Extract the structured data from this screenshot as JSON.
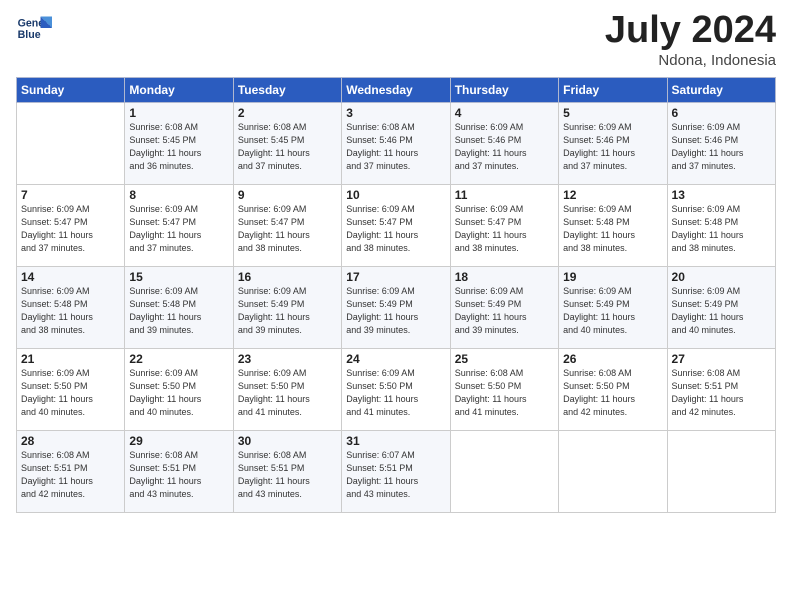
{
  "header": {
    "logo_line1": "General",
    "logo_line2": "Blue",
    "month": "July 2024",
    "location": "Ndona, Indonesia"
  },
  "weekdays": [
    "Sunday",
    "Monday",
    "Tuesday",
    "Wednesday",
    "Thursday",
    "Friday",
    "Saturday"
  ],
  "weeks": [
    [
      {
        "day": "",
        "info": ""
      },
      {
        "day": "1",
        "info": "Sunrise: 6:08 AM\nSunset: 5:45 PM\nDaylight: 11 hours\nand 36 minutes."
      },
      {
        "day": "2",
        "info": "Sunrise: 6:08 AM\nSunset: 5:45 PM\nDaylight: 11 hours\nand 37 minutes."
      },
      {
        "day": "3",
        "info": "Sunrise: 6:08 AM\nSunset: 5:46 PM\nDaylight: 11 hours\nand 37 minutes."
      },
      {
        "day": "4",
        "info": "Sunrise: 6:09 AM\nSunset: 5:46 PM\nDaylight: 11 hours\nand 37 minutes."
      },
      {
        "day": "5",
        "info": "Sunrise: 6:09 AM\nSunset: 5:46 PM\nDaylight: 11 hours\nand 37 minutes."
      },
      {
        "day": "6",
        "info": "Sunrise: 6:09 AM\nSunset: 5:46 PM\nDaylight: 11 hours\nand 37 minutes."
      }
    ],
    [
      {
        "day": "7",
        "info": "Sunrise: 6:09 AM\nSunset: 5:47 PM\nDaylight: 11 hours\nand 37 minutes."
      },
      {
        "day": "8",
        "info": "Sunrise: 6:09 AM\nSunset: 5:47 PM\nDaylight: 11 hours\nand 37 minutes."
      },
      {
        "day": "9",
        "info": "Sunrise: 6:09 AM\nSunset: 5:47 PM\nDaylight: 11 hours\nand 38 minutes."
      },
      {
        "day": "10",
        "info": "Sunrise: 6:09 AM\nSunset: 5:47 PM\nDaylight: 11 hours\nand 38 minutes."
      },
      {
        "day": "11",
        "info": "Sunrise: 6:09 AM\nSunset: 5:47 PM\nDaylight: 11 hours\nand 38 minutes."
      },
      {
        "day": "12",
        "info": "Sunrise: 6:09 AM\nSunset: 5:48 PM\nDaylight: 11 hours\nand 38 minutes."
      },
      {
        "day": "13",
        "info": "Sunrise: 6:09 AM\nSunset: 5:48 PM\nDaylight: 11 hours\nand 38 minutes."
      }
    ],
    [
      {
        "day": "14",
        "info": "Sunrise: 6:09 AM\nSunset: 5:48 PM\nDaylight: 11 hours\nand 38 minutes."
      },
      {
        "day": "15",
        "info": "Sunrise: 6:09 AM\nSunset: 5:48 PM\nDaylight: 11 hours\nand 39 minutes."
      },
      {
        "day": "16",
        "info": "Sunrise: 6:09 AM\nSunset: 5:49 PM\nDaylight: 11 hours\nand 39 minutes."
      },
      {
        "day": "17",
        "info": "Sunrise: 6:09 AM\nSunset: 5:49 PM\nDaylight: 11 hours\nand 39 minutes."
      },
      {
        "day": "18",
        "info": "Sunrise: 6:09 AM\nSunset: 5:49 PM\nDaylight: 11 hours\nand 39 minutes."
      },
      {
        "day": "19",
        "info": "Sunrise: 6:09 AM\nSunset: 5:49 PM\nDaylight: 11 hours\nand 40 minutes."
      },
      {
        "day": "20",
        "info": "Sunrise: 6:09 AM\nSunset: 5:49 PM\nDaylight: 11 hours\nand 40 minutes."
      }
    ],
    [
      {
        "day": "21",
        "info": "Sunrise: 6:09 AM\nSunset: 5:50 PM\nDaylight: 11 hours\nand 40 minutes."
      },
      {
        "day": "22",
        "info": "Sunrise: 6:09 AM\nSunset: 5:50 PM\nDaylight: 11 hours\nand 40 minutes."
      },
      {
        "day": "23",
        "info": "Sunrise: 6:09 AM\nSunset: 5:50 PM\nDaylight: 11 hours\nand 41 minutes."
      },
      {
        "day": "24",
        "info": "Sunrise: 6:09 AM\nSunset: 5:50 PM\nDaylight: 11 hours\nand 41 minutes."
      },
      {
        "day": "25",
        "info": "Sunrise: 6:08 AM\nSunset: 5:50 PM\nDaylight: 11 hours\nand 41 minutes."
      },
      {
        "day": "26",
        "info": "Sunrise: 6:08 AM\nSunset: 5:50 PM\nDaylight: 11 hours\nand 42 minutes."
      },
      {
        "day": "27",
        "info": "Sunrise: 6:08 AM\nSunset: 5:51 PM\nDaylight: 11 hours\nand 42 minutes."
      }
    ],
    [
      {
        "day": "28",
        "info": "Sunrise: 6:08 AM\nSunset: 5:51 PM\nDaylight: 11 hours\nand 42 minutes."
      },
      {
        "day": "29",
        "info": "Sunrise: 6:08 AM\nSunset: 5:51 PM\nDaylight: 11 hours\nand 43 minutes."
      },
      {
        "day": "30",
        "info": "Sunrise: 6:08 AM\nSunset: 5:51 PM\nDaylight: 11 hours\nand 43 minutes."
      },
      {
        "day": "31",
        "info": "Sunrise: 6:07 AM\nSunset: 5:51 PM\nDaylight: 11 hours\nand 43 minutes."
      },
      {
        "day": "",
        "info": ""
      },
      {
        "day": "",
        "info": ""
      },
      {
        "day": "",
        "info": ""
      }
    ]
  ]
}
